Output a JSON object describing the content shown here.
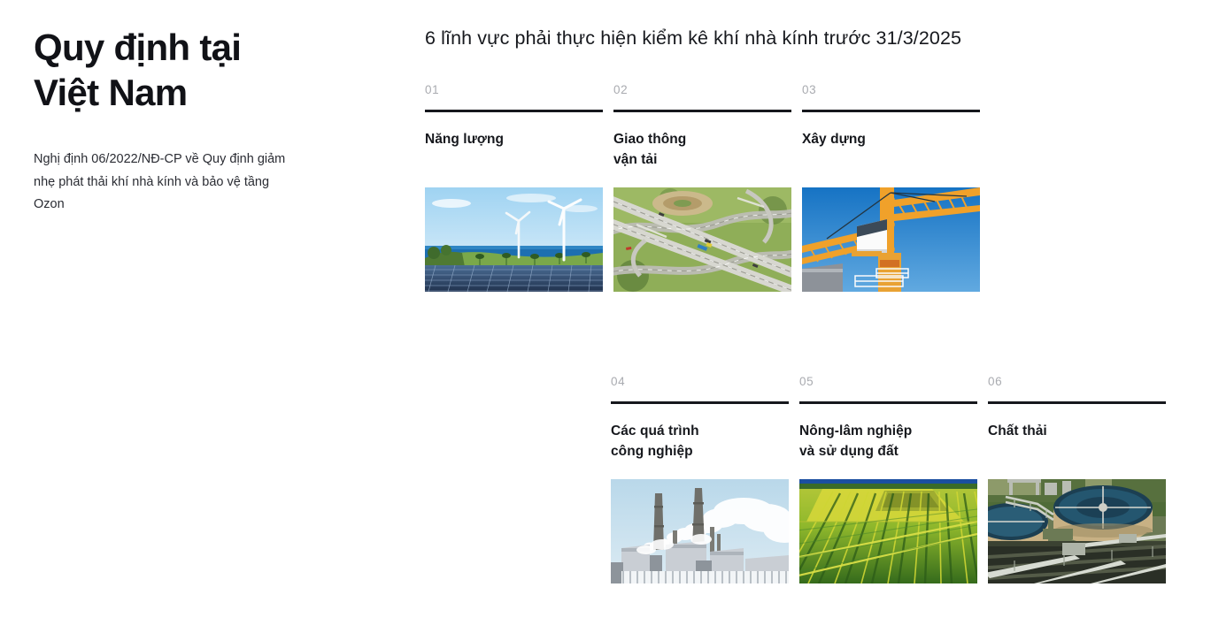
{
  "left": {
    "title": "Quy định tại\nViệt Nam",
    "subtitle": "Nghị định 06/2022/NĐ-CP về Quy định giảm nhẹ phát thải khí nhà kính và bảo vệ tầng Ozon"
  },
  "right": {
    "headline": "6 lĩnh vực phải thực hiện kiểm kê khí nhà kính trước 31/3/2025"
  },
  "colors": {
    "text": "#16181d",
    "muted_number": "#a9abb0",
    "rule": "#16181d",
    "background": "#ffffff"
  },
  "cards": [
    {
      "number": "01",
      "title": "Năng lượng",
      "image_name": "wind-turbines-solar-panels-photo",
      "image_alt": "Cánh đồng pin mặt trời và tua-bin gió bên bờ biển"
    },
    {
      "number": "02",
      "title": "Giao thông\nvận tải",
      "image_name": "highway-interchange-aerial-photo",
      "image_alt": "Ảnh chụp từ trên cao nút giao thông cao tốc nhiều tầng"
    },
    {
      "number": "03",
      "title": "Xây dựng",
      "image_name": "construction-tower-crane-photo",
      "image_alt": "Cần cẩu tháp màu vàng cam trên nền trời xanh"
    },
    {
      "number": "04",
      "title": "Các quá trình\ncông nghiệp",
      "image_name": "industrial-power-plant-smokestacks-photo",
      "image_alt": "Nhà máy công nghiệp với ống khói đang xả khói trắng"
    },
    {
      "number": "05",
      "title": "Nông-lâm nghiệp\nvà sử dụng đất",
      "image_name": "farmland-crop-fields-aerial-photo",
      "image_alt": "Ảnh từ trên cao các luống cây trồng vàng xanh"
    },
    {
      "number": "06",
      "title": "Chất thải",
      "image_name": "wastewater-treatment-plant-photo",
      "image_alt": "Nhà máy xử lý nước thải với các bể lắng tròn"
    }
  ]
}
